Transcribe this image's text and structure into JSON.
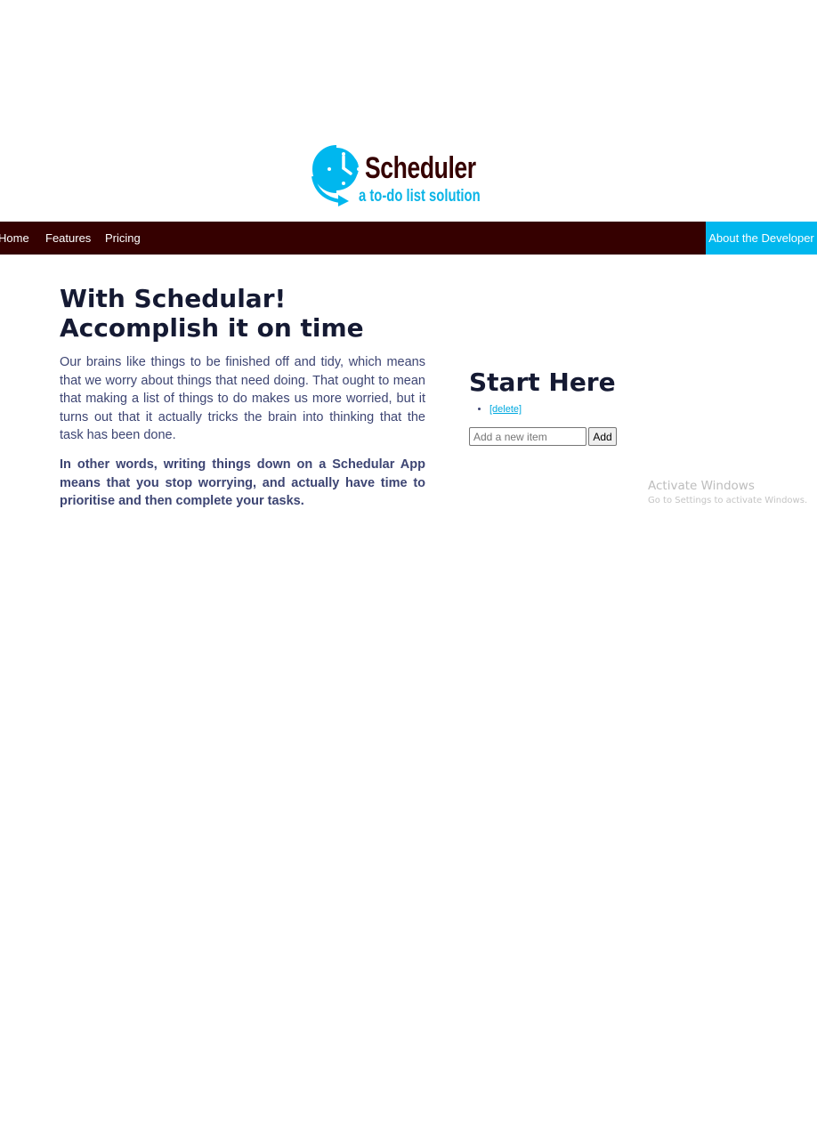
{
  "brand": {
    "logo_title": "Scheduler",
    "logo_tagline": "a to-do list solution",
    "logo_icon": "clock-icon",
    "colors": {
      "primary_dark": "#350000",
      "accent": "#00b7ee",
      "heading": "#151a33",
      "body_text": "#3d4573"
    }
  },
  "nav": {
    "items": [
      {
        "label": "Home"
      },
      {
        "label": "Features"
      },
      {
        "label": "Pricing"
      }
    ],
    "cta_label": "About the Developer"
  },
  "hero": {
    "title": "With Schedular! Accomplish it on time",
    "paragraph_1": "Our brains like things to be finished off and tidy, which means that we worry about things that need doing. That ought to mean that making a list of things to do makes us more worried, but it turns out that it actually tricks the brain into thinking that the task has been done.",
    "paragraph_2": "In other words, writing things down on a Schedular App means that you stop worrying, and actually have time to prioritise and then complete your tasks."
  },
  "todo": {
    "title": "Start Here",
    "items": [
      {
        "text": "",
        "delete_label": "[delete]"
      }
    ],
    "input_value": "",
    "input_placeholder": "Add a new item",
    "add_label": "Add"
  },
  "watermark": {
    "title": "Activate Windows",
    "subtitle": "Go to Settings to activate Windows."
  }
}
